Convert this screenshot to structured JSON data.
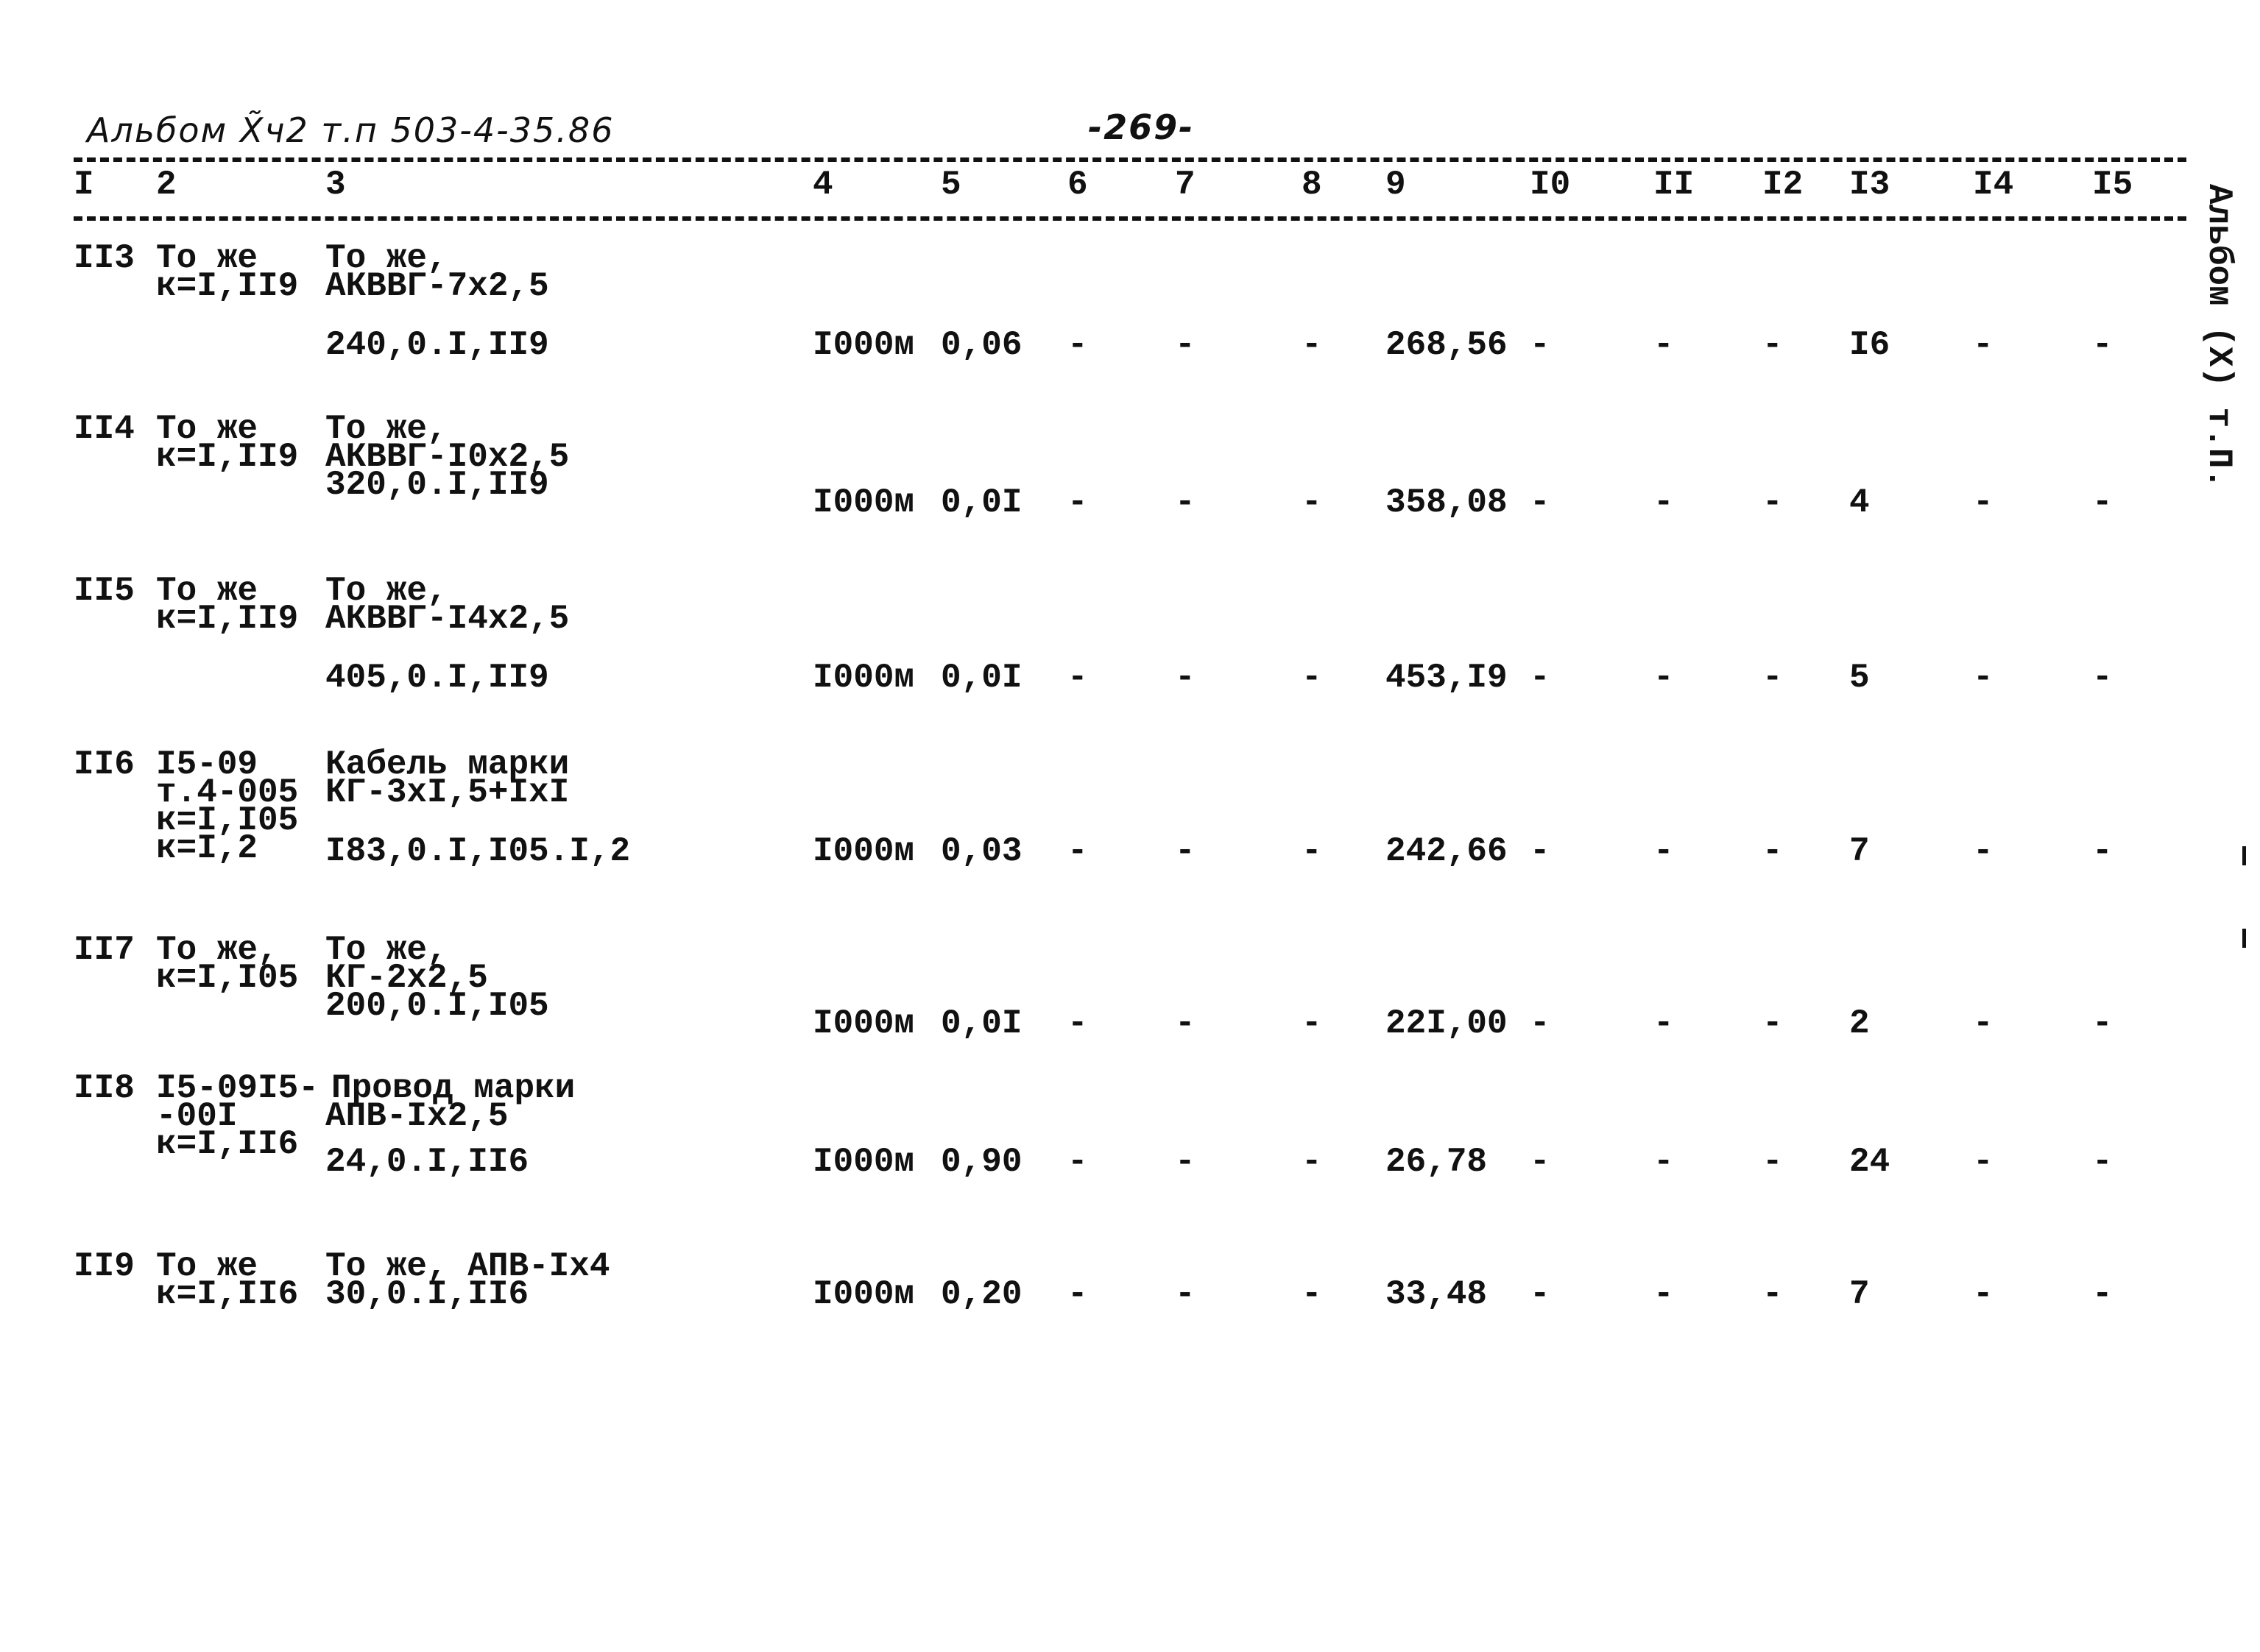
{
  "header": {
    "album_ref": "Альбом X̃ч2 т.п 503-4-35.86",
    "page_number": "-269-"
  },
  "column_numbers": [
    "I",
    "2",
    "3",
    "4",
    "5",
    "6",
    "7",
    "8",
    "9",
    "I0",
    "II",
    "I2",
    "I3",
    "I4",
    "I5"
  ],
  "side_label": "Альбом (X) т.П.",
  "rows": [
    {
      "num": "II3",
      "code": [
        "То же",
        "к=I,II9"
      ],
      "desc": [
        "То же,",
        "АКВВГ-7х2,5",
        "240,0.I,II9"
      ],
      "unit": "I000м",
      "qty": "0,06",
      "c6": "-",
      "c7": "-",
      "c8": "-",
      "c9": "268,56",
      "c10": "-",
      "c11": "-",
      "c12": "-",
      "c13": "I6",
      "c14": "-",
      "c15": "-"
    },
    {
      "num": "II4",
      "code": [
        "То же",
        "к=I,II9"
      ],
      "desc": [
        "То же,",
        "АКВВГ-I0х2,5",
        "320,0.I,II9"
      ],
      "unit": "I000м",
      "qty": "0,0I",
      "c6": "-",
      "c7": "-",
      "c8": "-",
      "c9": "358,08",
      "c10": "-",
      "c11": "-",
      "c12": "-",
      "c13": "4",
      "c14": "-",
      "c15": "-"
    },
    {
      "num": "II5",
      "code": [
        "То же",
        "к=I,II9"
      ],
      "desc": [
        "То же,",
        "АКВВГ-I4х2,5",
        "405,0.I,II9"
      ],
      "unit": "I000м",
      "qty": "0,0I",
      "c6": "-",
      "c7": "-",
      "c8": "-",
      "c9": "453,I9",
      "c10": "-",
      "c11": "-",
      "c12": "-",
      "c13": "5",
      "c14": "-",
      "c15": "-"
    },
    {
      "num": "II6",
      "code": [
        "I5-09",
        "т.4-005",
        "к=I,I05",
        "к=I,2"
      ],
      "desc": [
        "Кабель марки",
        "КГ-3хI,5+IхI",
        "I83,0.I,I05.I,2"
      ],
      "unit": "I000м",
      "qty": "0,03",
      "c6": "-",
      "c7": "-",
      "c8": "-",
      "c9": "242,66",
      "c10": "-",
      "c11": "-",
      "c12": "-",
      "c13": "7",
      "c14": "-",
      "c15": "-"
    },
    {
      "num": "II7",
      "code": [
        "То же,",
        "к=I,I05"
      ],
      "desc": [
        "То же,",
        "КГ-2х2,5",
        "200,0.I,I05"
      ],
      "unit": "I000м",
      "qty": "0,0I",
      "c6": "-",
      "c7": "-",
      "c8": "-",
      "c9": "22I,00",
      "c10": "-",
      "c11": "-",
      "c12": "-",
      "c13": "2",
      "c14": "-",
      "c15": "-"
    },
    {
      "num": "II8",
      "code": [
        "I5-09I5-",
        "-00I",
        "к=I,II6"
      ],
      "desc": [
        "Провод марки",
        "АПВ-Iх2,5",
        "24,0.I,II6"
      ],
      "unit": "I000м",
      "qty": "0,90",
      "c6": "-",
      "c7": "-",
      "c8": "-",
      "c9": "26,78",
      "c10": "-",
      "c11": "-",
      "c12": "-",
      "c13": "24",
      "c14": "-",
      "c15": "-"
    },
    {
      "num": "II9",
      "code": [
        "То же",
        "к=I,II6"
      ],
      "desc": [
        "То же, АПВ-Iх4",
        "30,0.I,II6"
      ],
      "unit": "I000м",
      "qty": "0,20",
      "c6": "-",
      "c7": "-",
      "c8": "-",
      "c9": "33,48",
      "c10": "-",
      "c11": "-",
      "c12": "-",
      "c13": "7",
      "c14": "-",
      "c15": "-"
    }
  ]
}
